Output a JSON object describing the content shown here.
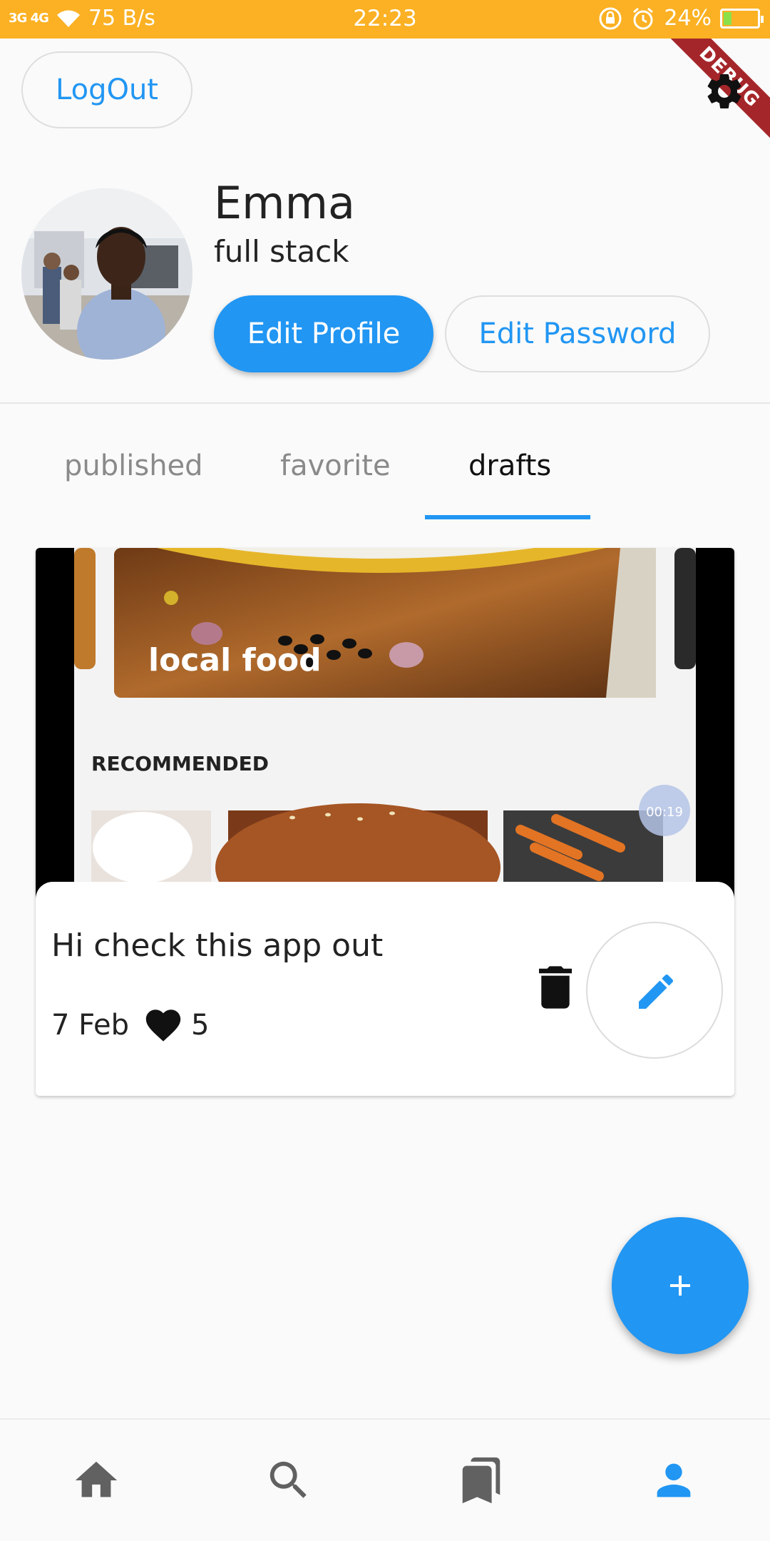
{
  "status_bar": {
    "signal": "3G 4G",
    "net_speed": "75 B/s",
    "time": "22:23",
    "battery": "24%",
    "battery_level": 0.24
  },
  "debug_banner": "DEBUG",
  "header": {
    "logout_label": "LogOut",
    "settings_icon": "gear-icon"
  },
  "profile": {
    "name": "Emma",
    "role": "full stack",
    "edit_profile_label": "Edit Profile",
    "edit_password_label": "Edit Password"
  },
  "tabs": [
    {
      "label": "published",
      "active": false
    },
    {
      "label": "favorite",
      "active": false
    },
    {
      "label": "drafts",
      "active": true
    }
  ],
  "draft": {
    "preview": {
      "banner_label": "local food",
      "section_label": "RECOMMENDED",
      "timer_badge": "00:19"
    },
    "title": "Hi check this app out",
    "date": "7 Feb",
    "likes": "5",
    "delete_icon": "trash-icon",
    "edit_icon": "pencil-icon"
  },
  "fab": {
    "icon": "plus-icon"
  },
  "bottom_nav": [
    {
      "icon": "home-icon",
      "active": false
    },
    {
      "icon": "search-icon",
      "active": false
    },
    {
      "icon": "bookmarks-icon",
      "active": false
    },
    {
      "icon": "person-icon",
      "active": true
    }
  ],
  "colors": {
    "accent": "#2196f3",
    "status_bar": "#fbb123",
    "debug_ribbon": "#a5262a",
    "inactive_icon": "#616161"
  }
}
